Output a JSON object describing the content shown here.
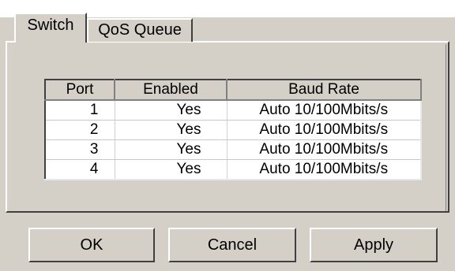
{
  "tabs": [
    {
      "label": "Switch",
      "selected": true
    },
    {
      "label": "QoS Queue",
      "selected": false
    }
  ],
  "table": {
    "headers": {
      "port": "Port",
      "enabled": "Enabled",
      "baud": "Baud Rate"
    },
    "rows": [
      {
        "port": "1",
        "enabled": "Yes",
        "baud": "Auto 10/100Mbits/s"
      },
      {
        "port": "2",
        "enabled": "Yes",
        "baud": "Auto 10/100Mbits/s"
      },
      {
        "port": "3",
        "enabled": "Yes",
        "baud": "Auto 10/100Mbits/s"
      },
      {
        "port": "4",
        "enabled": "Yes",
        "baud": "Auto 10/100Mbits/s"
      }
    ]
  },
  "buttons": {
    "ok": "OK",
    "cancel": "Cancel",
    "apply": "Apply"
  },
  "colors": {
    "face": "#d4d0c8",
    "highlight": "#ffffff",
    "shadow": "#404040"
  }
}
